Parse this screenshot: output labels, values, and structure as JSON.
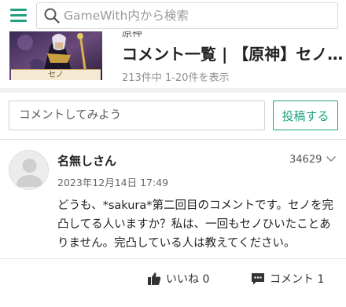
{
  "header": {
    "search_placeholder": "GameWith内から検索",
    "menu_icon": "hamburger-icon",
    "search_icon": "search-icon",
    "accent_color": "#21a17f"
  },
  "article": {
    "category": "原神",
    "title": "コメント一覧 | 【原神】セノ…",
    "meta": "213件中 1-20件を表示",
    "thumb_label": "セノ"
  },
  "comment_form": {
    "placeholder": "コメントしてみよう",
    "submit_label": "投稿する"
  },
  "comment": {
    "username": "名無しさん",
    "id": "34629",
    "timestamp": "2023年12月14日 17:49",
    "body": "どうも、*sakura*第二回目のコメントです。セノを完凸してる人いますか？私は、一回もセノひいたことありません。完凸している人は教えてください。",
    "like_label": "いいね 0",
    "reply_label": "コメント 1",
    "like_icon": "thumbs-up-icon",
    "reply_icon": "speech-bubble-icon"
  }
}
